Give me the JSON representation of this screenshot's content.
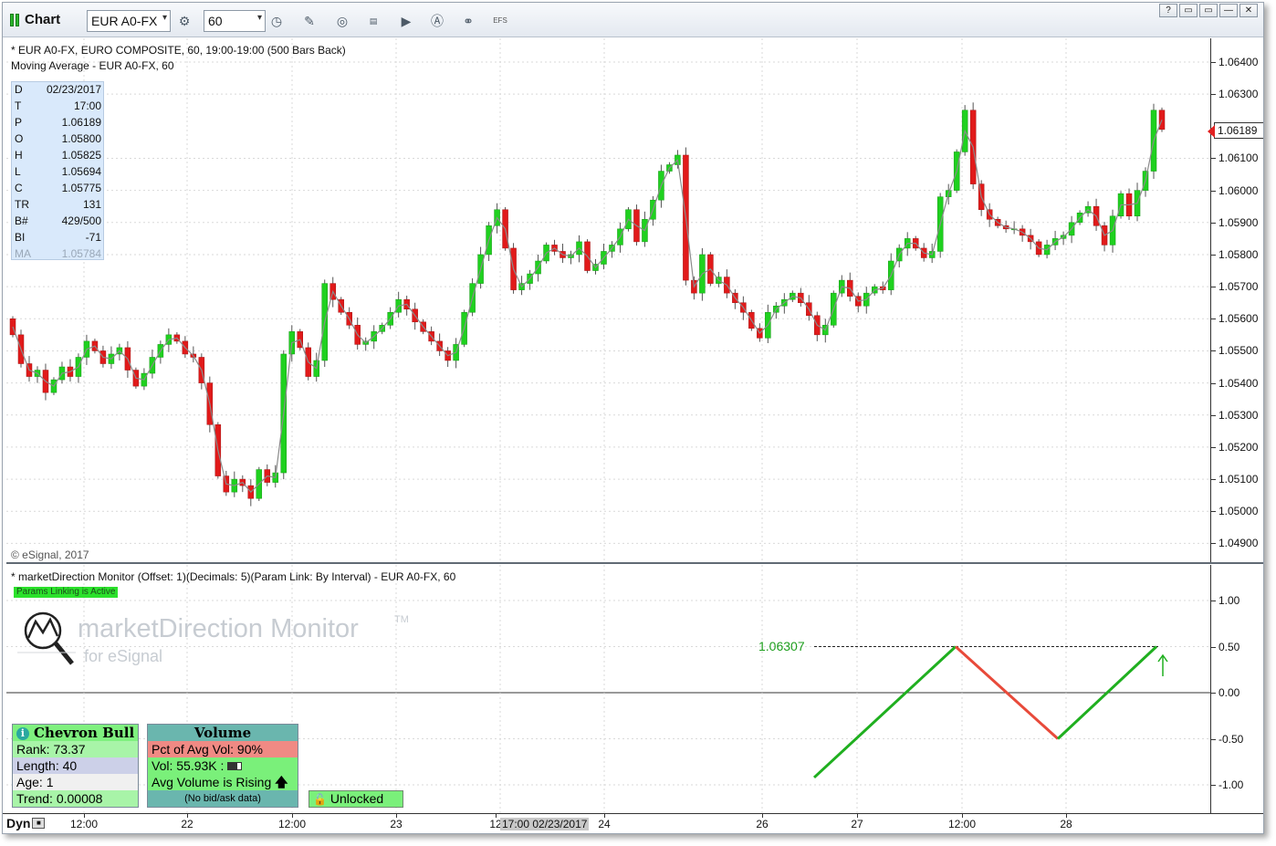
{
  "toolbar": {
    "title": "Chart",
    "symbol": "EUR A0-FX",
    "interval": "60",
    "efs_label": "EFS",
    "icons": [
      "settings-icon",
      "clock-icon",
      "pencil-icon",
      "chart-icon",
      "get-icon",
      "play-icon",
      "alert-icon",
      "link-icon",
      "efs-icon"
    ],
    "window_buttons": [
      "?",
      "▭",
      "▭",
      "—",
      "✕"
    ]
  },
  "price_pane": {
    "title_line": "* EUR A0-FX, EURO COMPOSITE, 60, 19:00-19:00 (500 Bars Back)",
    "study_line": "Moving Average - EUR A0-FX, 60",
    "copyright": "© eSignal, 2017",
    "current_price": "1.06189",
    "data_window": [
      {
        "label": "D",
        "value": "02/23/2017"
      },
      {
        "label": "T",
        "value": "17:00"
      },
      {
        "label": "P",
        "value": "1.06189"
      },
      {
        "label": "O",
        "value": "1.05800"
      },
      {
        "label": "H",
        "value": "1.05825"
      },
      {
        "label": "L",
        "value": "1.05694"
      },
      {
        "label": "C",
        "value": "1.05775"
      },
      {
        "label": "TR",
        "value": "131"
      },
      {
        "label": "B#",
        "value": "429/500"
      },
      {
        "label": "BI",
        "value": "-71"
      },
      {
        "label": "MA",
        "value": "1.05784"
      }
    ],
    "y_labels": [
      "1.06400",
      "1.06300",
      "1.06100",
      "1.06000",
      "1.05900",
      "1.05800",
      "1.05700",
      "1.05600",
      "1.05500",
      "1.05400",
      "1.05300",
      "1.05200",
      "1.05100",
      "1.05000",
      "1.04900"
    ]
  },
  "indicator_pane": {
    "title_line": "* marketDirection Monitor (Offset: 1)(Decimals: 5)(Param Link: By Interval) - EUR A0-FX, 60",
    "params_badge": "Params Linking is Active",
    "logo_text": "marketDirection Monitor",
    "logo_tm": "TM",
    "logo_sub": "for eSignal",
    "level_label": "1.06307",
    "y_labels": [
      "1.00",
      "0.50",
      "0.00",
      "-0.50",
      "-1.00"
    ],
    "chevron": {
      "title": "Chevron Bull",
      "rank": "Rank: 73.37",
      "length": "Length: 40",
      "age": "Age: 1",
      "trend": "Trend: 0.00008"
    },
    "volume": {
      "title": "Volume",
      "pct": "Pct of Avg Vol: 90%",
      "vol": "Vol: 55.93K :",
      "avg": "Avg Volume is Rising",
      "bidask": "(No bid/ask data)"
    },
    "unlocked": "Unlocked"
  },
  "x_axis": {
    "dyn_label": "Dyn",
    "labels": [
      "12:00",
      "22",
      "12:00",
      "23",
      "12",
      "24",
      "26",
      "27",
      "12:00",
      "28"
    ],
    "cursor_time": "17:00 02/23/2017"
  },
  "colors": {
    "up": "#1fd11f",
    "down": "#e11a1a",
    "ma": "#8a8a8a",
    "indicator_up": "#1faf1f",
    "indicator_down": "#e84a3a",
    "chevron_header": "#7ff07f",
    "volume_header": "#6ab6ae"
  },
  "chart_data": {
    "type": "candlestick",
    "price_unit": "EUR/USD",
    "close": [
      1.0555,
      1.0546,
      1.0542,
      1.0544,
      1.0537,
      1.0541,
      1.0545,
      1.0542,
      1.0548,
      1.0553,
      1.055,
      1.0546,
      1.0549,
      1.0551,
      1.0544,
      1.0539,
      1.0543,
      1.0548,
      1.0552,
      1.0555,
      1.0553,
      1.0549,
      1.0548,
      1.054,
      1.0527,
      1.0511,
      1.0506,
      1.051,
      1.0508,
      1.0504,
      1.0513,
      1.0509,
      1.0512,
      1.0549,
      1.0556,
      1.0551,
      1.0542,
      1.0547,
      1.0571,
      1.0566,
      1.0562,
      1.0558,
      1.0552,
      1.0553,
      1.0556,
      1.0558,
      1.0562,
      1.0566,
      1.0563,
      1.0559,
      1.0556,
      1.0553,
      1.055,
      1.0547,
      1.0552,
      1.0562,
      1.0571,
      1.058,
      1.0589,
      1.0594,
      1.0582,
      1.0569,
      1.0571,
      1.0574,
      1.0578,
      1.0583,
      1.0581,
      1.0579,
      1.058,
      1.0584,
      1.0575,
      1.0577,
      1.0581,
      1.0583,
      1.0588,
      1.0594,
      1.0584,
      1.0591,
      1.0597,
      1.0606,
      1.0608,
      1.0611,
      1.0572,
      1.0568,
      1.058,
      1.0571,
      1.0573,
      1.0568,
      1.0565,
      1.0562,
      1.0557,
      1.0554,
      1.0562,
      1.0564,
      1.0566,
      1.0568,
      1.0565,
      1.0561,
      1.0555,
      1.0558,
      1.0568,
      1.0572,
      1.0567,
      1.0564,
      1.0568,
      1.057,
      1.0569,
      1.0578,
      1.0582,
      1.0585,
      1.0582,
      1.0579,
      1.0581,
      1.0598,
      1.06,
      1.0612,
      1.0625,
      1.0602,
      1.0594,
      1.0591,
      1.0589,
      1.0588,
      1.0588,
      1.0586,
      1.0584,
      1.058,
      1.0583,
      1.0585,
      1.0586,
      1.059,
      1.0593,
      1.0595,
      1.0589,
      1.0583,
      1.0592,
      1.0599,
      1.0592,
      1.06,
      1.0606,
      1.0625,
      1.0619
    ]
  }
}
